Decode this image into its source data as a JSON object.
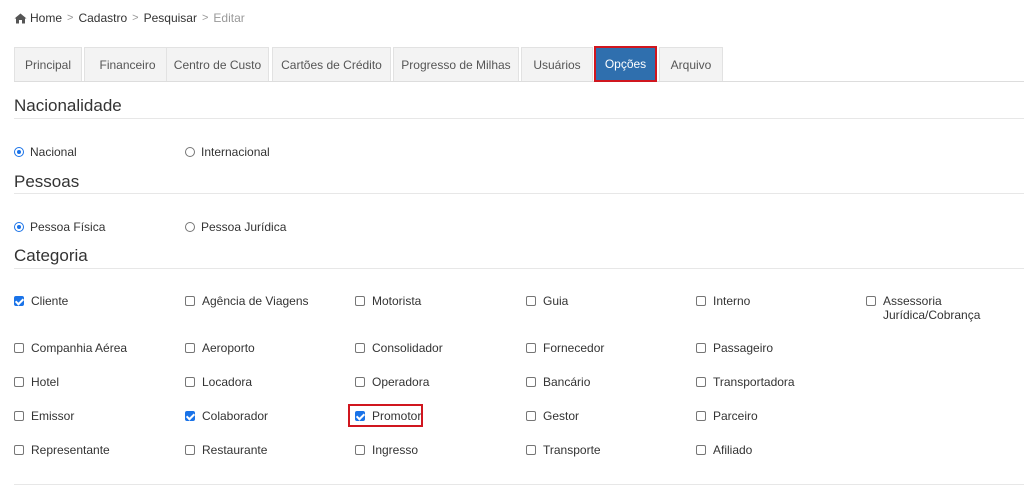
{
  "breadcrumb": {
    "home": "Home",
    "cadastro": "Cadastro",
    "pesquisar": "Pesquisar",
    "editar": "Editar",
    "separator": ">"
  },
  "tabs": [
    "Principal",
    "Financeiro",
    "Centro de Custo",
    "Cartões de Crédito",
    "Progresso de Milhas",
    "Usuários",
    "Opções",
    "Arquivo"
  ],
  "active_tab": "Opções",
  "nacionalidade": {
    "title": "Nacionalidade",
    "options": [
      "Nacional",
      "Internacional"
    ],
    "selected": "Nacional"
  },
  "pessoas": {
    "title": "Pessoas",
    "options": [
      "Pessoa Física",
      "Pessoa Jurídica"
    ],
    "selected": "Pessoa Física"
  },
  "categoria": {
    "title": "Categoria",
    "rows": [
      [
        {
          "label": "Cliente",
          "checked": true
        },
        {
          "label": "Agência de Viagens",
          "checked": false
        },
        {
          "label": "Motorista",
          "checked": false
        },
        {
          "label": "Guia",
          "checked": false
        },
        {
          "label": "Interno",
          "checked": false
        },
        {
          "label": "Assessoria Jurídica/Cobrança",
          "checked": false
        }
      ],
      [
        {
          "label": "Companhia Aérea",
          "checked": false
        },
        {
          "label": "Aeroporto",
          "checked": false
        },
        {
          "label": "Consolidador",
          "checked": false
        },
        {
          "label": "Fornecedor",
          "checked": false
        },
        {
          "label": "Passageiro",
          "checked": false
        }
      ],
      [
        {
          "label": "Hotel",
          "checked": false
        },
        {
          "label": "Locadora",
          "checked": false
        },
        {
          "label": "Operadora",
          "checked": false
        },
        {
          "label": "Bancário",
          "checked": false
        },
        {
          "label": "Transportadora",
          "checked": false
        }
      ],
      [
        {
          "label": "Emissor",
          "checked": false
        },
        {
          "label": "Colaborador",
          "checked": true
        },
        {
          "label": "Promotor",
          "checked": true
        },
        {
          "label": "Gestor",
          "checked": false
        },
        {
          "label": "Parceiro",
          "checked": false
        }
      ],
      [
        {
          "label": "Representante",
          "checked": false
        },
        {
          "label": "Restaurante",
          "checked": false
        },
        {
          "label": "Ingresso",
          "checked": false
        },
        {
          "label": "Transporte",
          "checked": false
        },
        {
          "label": "Afiliado",
          "checked": false
        }
      ]
    ]
  },
  "colors": {
    "active_tab_bg": "#2f6fae",
    "highlight": "#d0161f",
    "checkbox_accent": "#1a73e8"
  },
  "icons": {
    "home": "home-icon"
  }
}
